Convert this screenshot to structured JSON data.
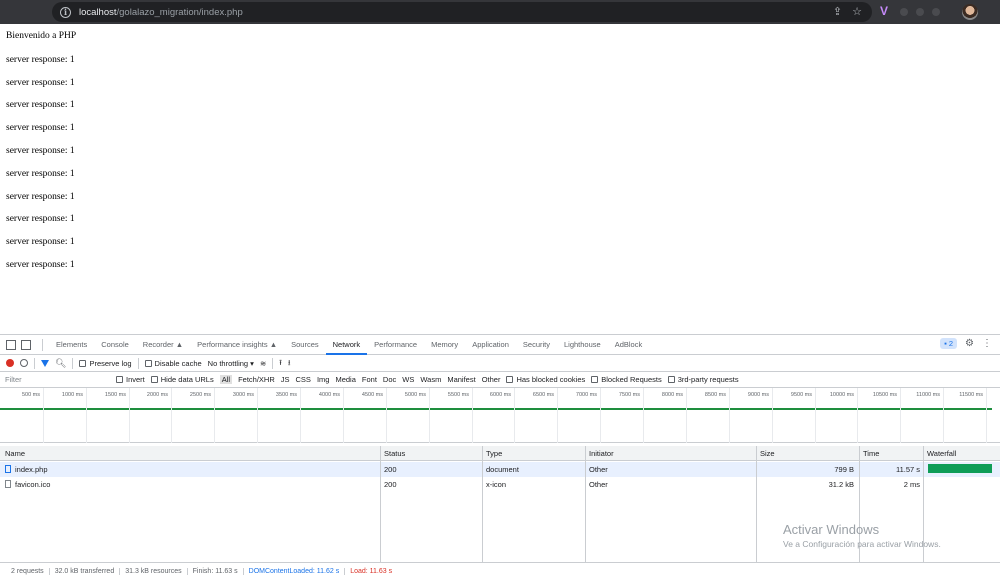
{
  "browser": {
    "url_host": "localhost",
    "url_path": "/golalazo_migration/index.php"
  },
  "page": {
    "welcome": "Bienvenido a PHP",
    "lines": [
      "server response: 1",
      "server response: 1",
      "server response: 1",
      "server response: 1",
      "server response: 1",
      "server response: 1",
      "server response: 1",
      "server response: 1",
      "server response: 1",
      "server response: 1"
    ]
  },
  "devtools": {
    "tabs": [
      "Elements",
      "Console",
      "Recorder ▲",
      "Performance insights ▲",
      "Sources",
      "Network",
      "Performance",
      "Memory",
      "Application",
      "Security",
      "Lighthouse",
      "AdBlock"
    ],
    "active_tab": "Network",
    "issues_count": "2",
    "toolbar": {
      "preserve_log": "Preserve log",
      "disable_cache": "Disable cache",
      "throttling": "No throttling"
    },
    "filter": {
      "placeholder": "Filter",
      "invert": "Invert",
      "hide_data_urls": "Hide data URLs",
      "types": [
        "All",
        "Fetch/XHR",
        "JS",
        "CSS",
        "Img",
        "Media",
        "Font",
        "Doc",
        "WS",
        "Wasm",
        "Manifest",
        "Other"
      ],
      "has_blocked_cookies": "Has blocked cookies",
      "blocked_requests": "Blocked Requests",
      "third_party": "3rd-party requests"
    },
    "timeline_ticks": [
      "500 ms",
      "1000 ms",
      "1500 ms",
      "2000 ms",
      "2500 ms",
      "3000 ms",
      "3500 ms",
      "4000 ms",
      "4500 ms",
      "5000 ms",
      "5500 ms",
      "6000 ms",
      "6500 ms",
      "7000 ms",
      "7500 ms",
      "8000 ms",
      "8500 ms",
      "9000 ms",
      "9500 ms",
      "10000 ms",
      "10500 ms",
      "11000 ms",
      "11500 ms"
    ],
    "table": {
      "columns": [
        "Name",
        "Status",
        "Type",
        "Initiator",
        "Size",
        "Time",
        "Waterfall"
      ],
      "rows": [
        {
          "name": "index.php",
          "status": "200",
          "type": "document",
          "initiator": "Other",
          "size": "799 B",
          "time": "11.57 s"
        },
        {
          "name": "favicon.ico",
          "status": "200",
          "type": "x-icon",
          "initiator": "Other",
          "size": "31.2 kB",
          "time": "2 ms"
        }
      ]
    },
    "status_bar": {
      "requests": "2 requests",
      "transferred": "32.0 kB transferred",
      "resources": "31.3 kB resources",
      "finish": "Finish: 11.63 s",
      "dom_content_loaded": "DOMContentLoaded: 11.62 s",
      "load": "Load: 11.63 s"
    }
  },
  "watermark": {
    "line1": "Activar Windows",
    "line2": "Ve a Configuración para activar Windows."
  },
  "colors": {
    "accent": "#1a73e8",
    "waterfall_bar": "#0f9d58",
    "record": "#d93025"
  }
}
